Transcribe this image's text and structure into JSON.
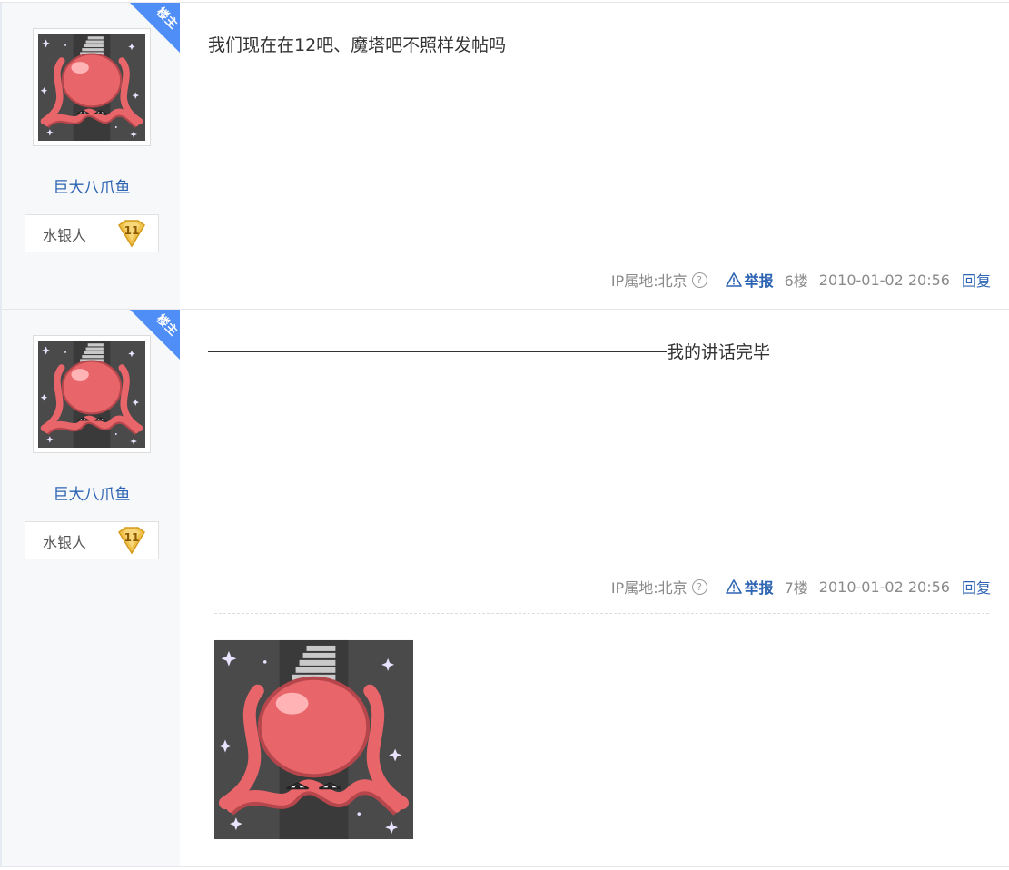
{
  "posts": [
    {
      "badge": "楼主",
      "username": "巨大八爪鱼",
      "level_name": "水银人",
      "level_number": "11",
      "content": "我们现在在12吧、魔塔吧不照样发帖吗",
      "ip_location": "IP属地:北京",
      "help_icon": "?",
      "report_label": "举报",
      "floor": "6楼",
      "time": "2010-01-02 20:56",
      "reply_label": "回复"
    },
    {
      "badge": "楼主",
      "username": "巨大八爪鱼",
      "level_name": "水银人",
      "level_number": "11",
      "content": "我的讲话完毕",
      "ip_location": "IP属地:北京",
      "help_icon": "?",
      "report_label": "举报",
      "floor": "7楼",
      "time": "2010-01-02 20:56",
      "reply_label": "回复"
    }
  ],
  "colors": {
    "link": "#2d64b3",
    "badge": "#4f8ef7",
    "octopus": "#e8656a",
    "tile": "#4a4a4a",
    "level_gold": "#f0c24b"
  },
  "icons": [
    "help-icon",
    "warning-icon",
    "octopus-avatar",
    "level-badge-icon",
    "owner-badge"
  ]
}
